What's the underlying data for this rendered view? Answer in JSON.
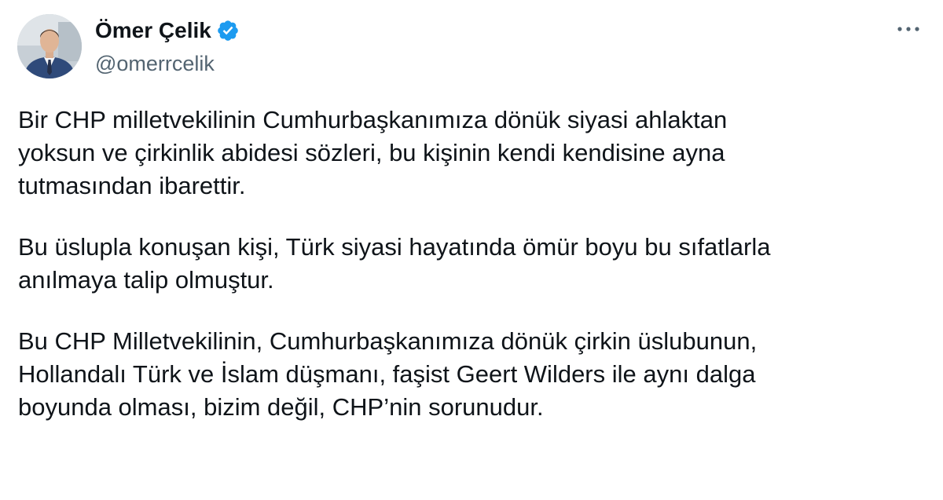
{
  "author": {
    "name": "Ömer Çelik",
    "handle": "@omerrcelik",
    "avatar_icon": "profile-photo",
    "verified_icon": "verified-badge-icon",
    "verified_color": "#1d9bf0"
  },
  "menu": {
    "more_icon": "more-options-icon"
  },
  "tweet": {
    "paragraphs": [
      "Bir CHP milletvekilinin Cumhurbaşkanımıza dönük siyasi ahlaktan\nyoksun ve çirkinlik abidesi sözleri, bu kişinin kendi kendisine ayna\ntutmasından ibarettir.",
      "Bu üslupla konuşan kişi, Türk siyasi hayatında ömür boyu bu sıfatlarla\nanılmaya talip olmuştur.",
      "Bu CHP Milletvekilinin, Cumhurbaşkanımıza dönük çirkin üslubunun,\nHollandalı Türk ve İslam düşmanı, faşist Geert Wilders ile aynı dalga\nboyunda olması, bizim değil, CHP’nin sorunudur."
    ]
  }
}
